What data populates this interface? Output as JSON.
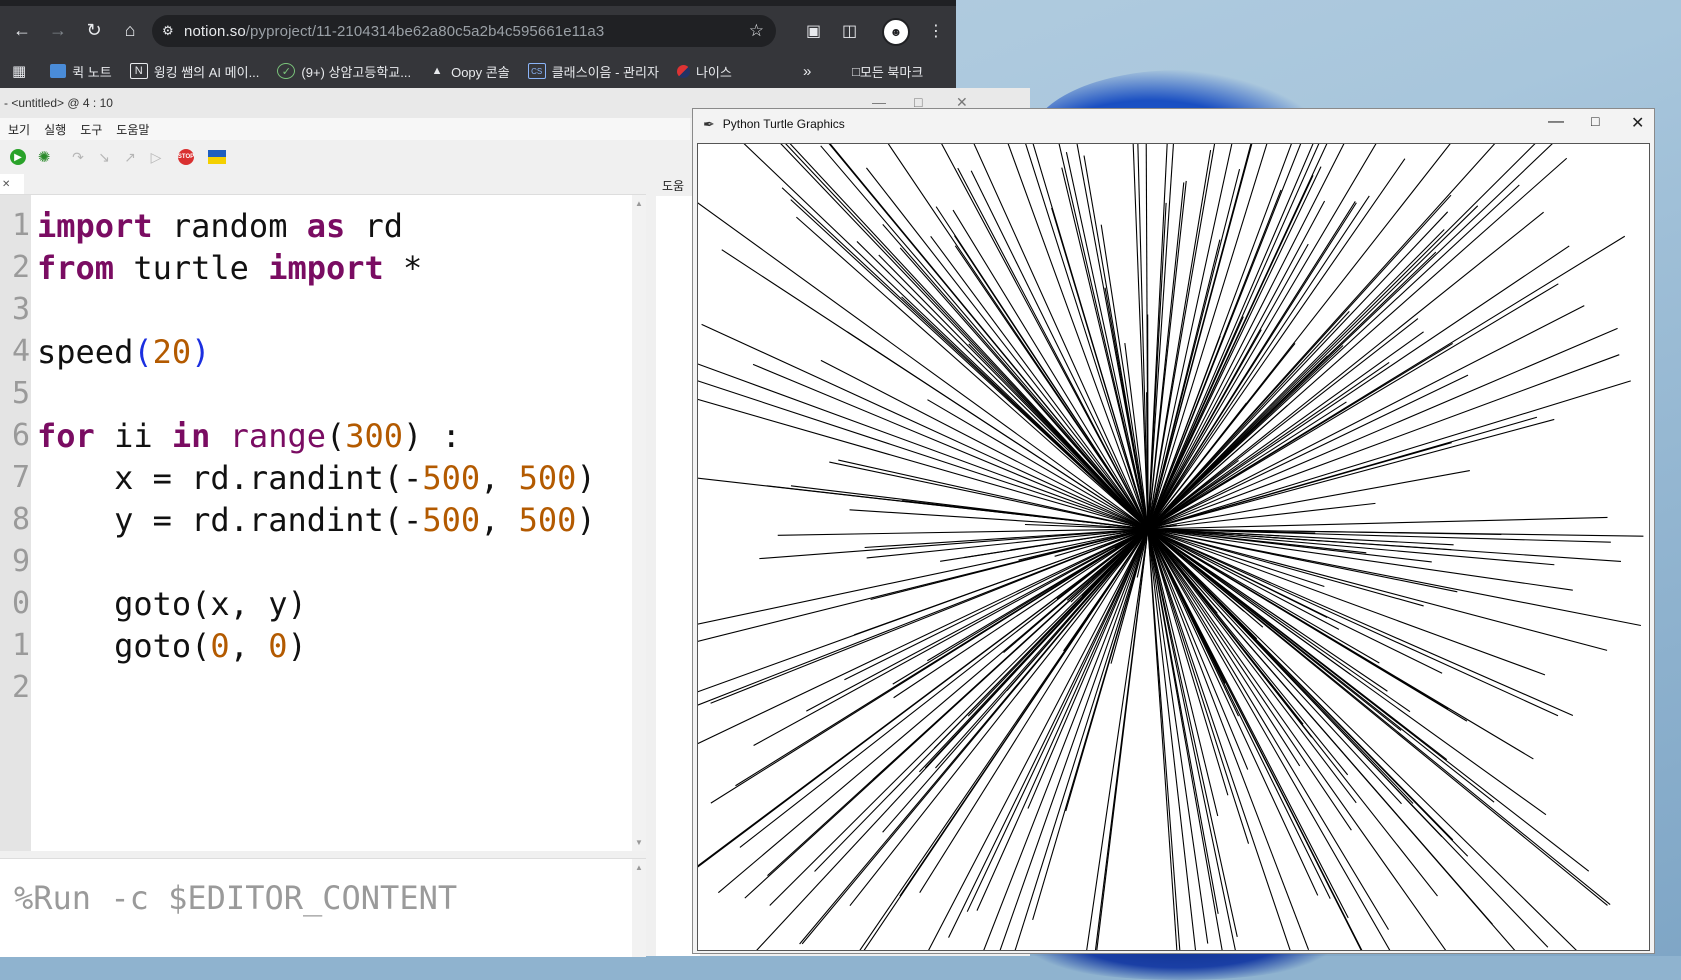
{
  "browser": {
    "url_host": "notion.so",
    "url_path": "/pyproject/11-2104314be62a80c5a2b4c595661e11a3",
    "bookmarks": [
      {
        "label": "퀵 노트",
        "icon": "quicknote-icon"
      },
      {
        "label": "윙킹 쌤의 AI 메이...",
        "icon": "notion-icon"
      },
      {
        "label": "(9+) 상암고등학교...",
        "icon": "school-icon"
      },
      {
        "label": "Oopy 콘솔",
        "icon": "oopy-icon"
      },
      {
        "label": "클래스이음 - 관리자",
        "icon": "class-icon"
      },
      {
        "label": "나이스",
        "icon": "neis-icon"
      }
    ],
    "all_bookmarks": "모든 북마크"
  },
  "thonny": {
    "title": "- <untitled> @ 4 : 10",
    "menu": [
      "보기",
      "실행",
      "도구",
      "도움말"
    ],
    "assistant_tab": "도움",
    "line_numbers": [
      "1",
      "2",
      "3",
      "4",
      "5",
      "6",
      "7",
      "8",
      "9",
      "0",
      "1",
      "2"
    ],
    "shell_command": "%Run -c $EDITOR_CONTENT"
  },
  "turtle_window": {
    "title": "Python Turtle Graphics",
    "center": [
      0,
      0
    ],
    "range": [
      -500,
      500
    ],
    "line_count": 300
  }
}
